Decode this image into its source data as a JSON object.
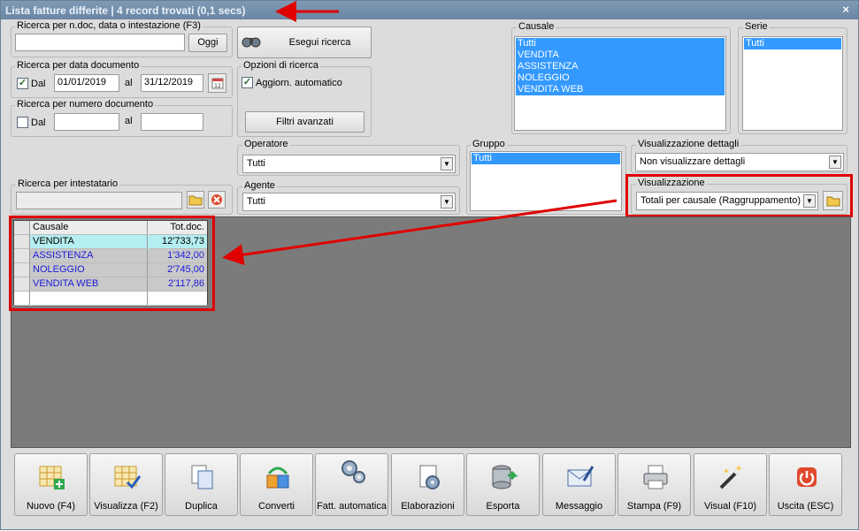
{
  "window": {
    "title": "Lista fatture differite | 4 record trovati (0,1 secs)",
    "close": "×"
  },
  "search_text": {
    "group_label": "Ricerca per n.doc, data o intestazione (F3)",
    "value": "",
    "today_button": "Oggi"
  },
  "search_button": "Esegui ricerca",
  "date_search": {
    "group_label": "Ricerca per data documento",
    "from_checked": true,
    "from_label": "Dal",
    "from_value": "01/01/2019",
    "to_label": "al",
    "to_value": "31/12/2019"
  },
  "number_search": {
    "group_label": "Ricerca per numero documento",
    "from_checked": false,
    "from_label": "Dal",
    "from_value": "",
    "to_label": "al",
    "to_value": ""
  },
  "search_options": {
    "group_label": "Opzioni di ricerca",
    "auto_update_checked": true,
    "auto_update_label": "Aggiorn. automatico",
    "advanced_filters": "Filtri avanzati"
  },
  "causale": {
    "group_label": "Causale",
    "options": [
      "Tutti",
      "VENDITA",
      "ASSISTENZA",
      "NOLEGGIO",
      "VENDITA WEB"
    ]
  },
  "serie": {
    "group_label": "Serie",
    "options": [
      "Tutti"
    ]
  },
  "operatore": {
    "group_label": "Operatore",
    "value": "Tutti"
  },
  "agente": {
    "group_label": "Agente",
    "value": "Tutti"
  },
  "gruppo": {
    "group_label": "Gruppo",
    "options": [
      "Tutti"
    ]
  },
  "dettagli": {
    "group_label": "Visualizzazione dettagli",
    "value": "Non visualizzare dettagli"
  },
  "visualizzazione": {
    "group_label": "Visualizzazione",
    "value": "Totali per causale (Raggruppamento)"
  },
  "intestatario": {
    "group_label": "Ricerca per intestatario",
    "value": ""
  },
  "grid": {
    "headers": [
      "Causale",
      "Tot.doc."
    ],
    "rows": [
      {
        "causale": "VENDITA",
        "totale": "12'733,73"
      },
      {
        "causale": "ASSISTENZA",
        "totale": "1'342,00"
      },
      {
        "causale": "NOLEGGIO",
        "totale": "2'745,00"
      },
      {
        "causale": "VENDITA WEB",
        "totale": "2'117,86"
      }
    ]
  },
  "toolbar": [
    {
      "label": "Nuovo (F4)",
      "icon": "new-grid-icon"
    },
    {
      "label": "Visualizza (F2)",
      "icon": "view-grid-icon"
    },
    {
      "label": "Duplica",
      "icon": "duplicate-icon"
    },
    {
      "label": "Converti",
      "icon": "convert-icon"
    },
    {
      "label": "Fatt. automatica",
      "icon": "gears-icon"
    },
    {
      "label": "Elaborazioni",
      "icon": "process-icon"
    },
    {
      "label": "Esporta",
      "icon": "export-db-icon"
    },
    {
      "label": "Messaggio",
      "icon": "message-icon"
    },
    {
      "label": "Stampa (F9)",
      "icon": "printer-icon"
    },
    {
      "label": "Visual (F10)",
      "icon": "magic-wand-icon"
    },
    {
      "label": "Uscita (ESC)",
      "icon": "power-icon"
    }
  ],
  "colors": {
    "selection": "#3399ff",
    "highlight_row": "#b4eef0",
    "annotation": "#e00000",
    "title_bar": "#6a86a3",
    "grid_bg": "#7b7b7b"
  }
}
